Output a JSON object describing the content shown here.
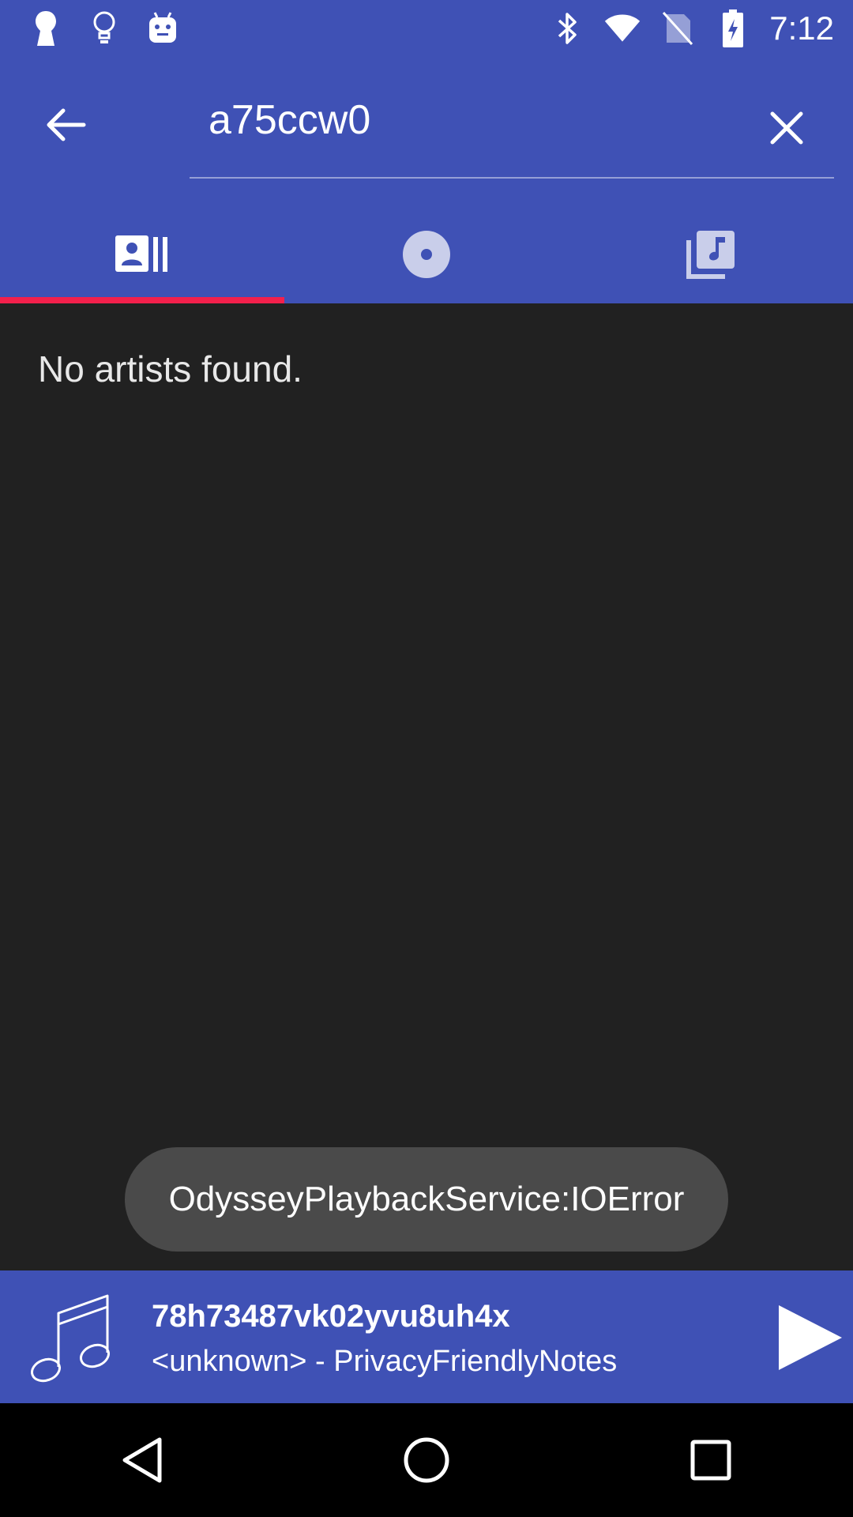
{
  "status_bar": {
    "time": "7:12",
    "left_icons": [
      "keyhole-icon",
      "lightbulb-icon",
      "android-icon"
    ],
    "right_icons": [
      "bluetooth-icon",
      "wifi-icon",
      "no-sim-icon",
      "battery-charging-icon"
    ]
  },
  "search": {
    "query": "a75ccw0"
  },
  "tabs": [
    {
      "icon": "artists-icon",
      "selected": true
    },
    {
      "icon": "album-icon",
      "selected": false
    },
    {
      "icon": "tracks-icon",
      "selected": false
    }
  ],
  "content": {
    "empty_message": "No artists found."
  },
  "toast": {
    "message": "OdysseyPlaybackService:IOError"
  },
  "now_playing": {
    "title": "78h73487vk02yvu8uh4x",
    "subtitle": "<unknown> - PrivacyFriendlyNotes",
    "art_icon": "music-note-icon",
    "action_icon": "play-icon"
  },
  "nav_bar": {
    "buttons": [
      "back-nav-icon",
      "home-nav-icon",
      "recents-nav-icon"
    ]
  },
  "colors": {
    "primary": "#3f51b5",
    "accent": "#f3204c",
    "background": "#212121",
    "toast": "#4a4a4a"
  }
}
